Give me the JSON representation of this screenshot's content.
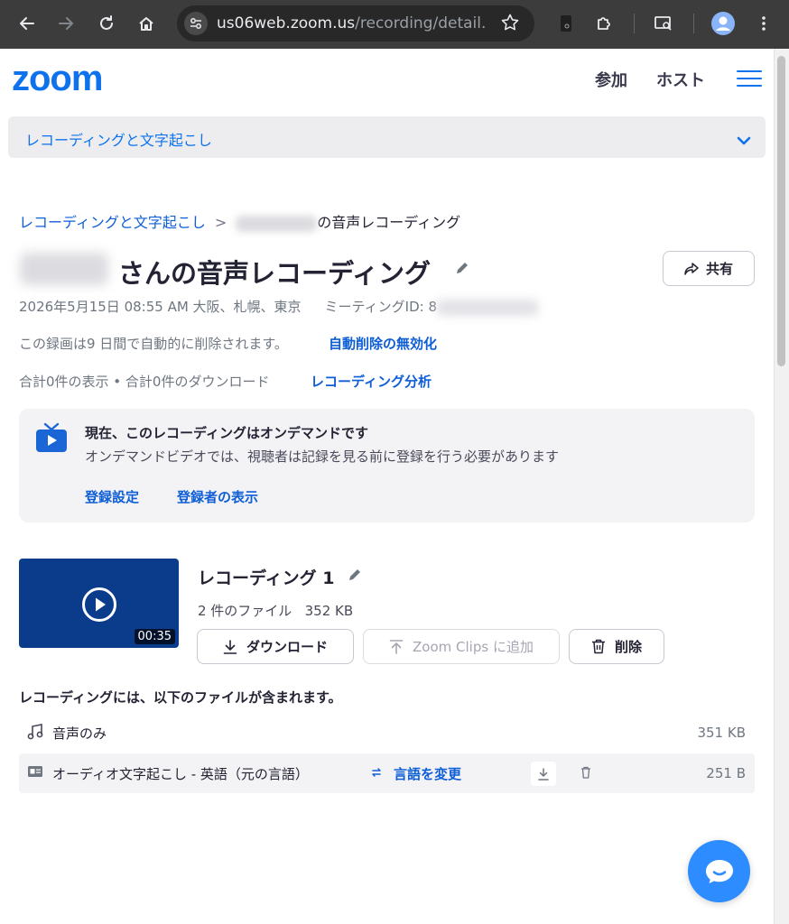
{
  "browser": {
    "url_host": "us06web.zoom.us",
    "url_path": "/recording/detail..."
  },
  "header": {
    "logo_text": "zoom",
    "join_label": "参加",
    "host_label": "ホスト"
  },
  "subnav": {
    "label": "レコーディングと文字起こし"
  },
  "breadcrumb": {
    "parent": "レコーディングと文字起こし",
    "separator": ">",
    "current_suffix": "の音声レコーディング"
  },
  "title": {
    "text": "さんの音声レコーディング",
    "share_label": "共有"
  },
  "meta": {
    "datetime": "2026年5月15日 08:55 AM 大阪、札幌、東京",
    "meeting_id_label": "ミーティングID: 8"
  },
  "deletion": {
    "note": "この録画は9 日間で自動的に削除されます。",
    "disable_link": "自動削除の無効化"
  },
  "stats": {
    "counts": "合計0件の表示 • 合計0件のダウンロード",
    "analysis_link": "レコーディング分析"
  },
  "ondemand": {
    "title": "現在、このレコーディングはオンデマンドです",
    "description": "オンデマンドビデオでは、視聴者は記録を見る前に登録を行う必要があります",
    "settings_link": "登録設定",
    "registrants_link": "登録者の表示"
  },
  "recording": {
    "title": "レコーディング 1",
    "duration": "00:35",
    "file_count": "2 件のファイル",
    "total_size": "352 KB",
    "download_label": "ダウンロード",
    "clips_label": "Zoom Clips に追加",
    "delete_label": "削除"
  },
  "files": {
    "heading": "レコーディングには、以下のファイルが含まれます。",
    "items": [
      {
        "name": "音声のみ",
        "size": "351 KB",
        "icon": "music-note-icon"
      },
      {
        "name": "オーディオ文字起こし - 英語（元の言語）",
        "size": "251 B",
        "icon": "transcript-icon",
        "action": "言語を変更"
      }
    ]
  },
  "colors": {
    "brand_blue": "#0e72ed",
    "link_blue": "#0e5ed6",
    "thumbnail_bg": "#0b3c8c",
    "chat_button": "#2d8cff"
  }
}
